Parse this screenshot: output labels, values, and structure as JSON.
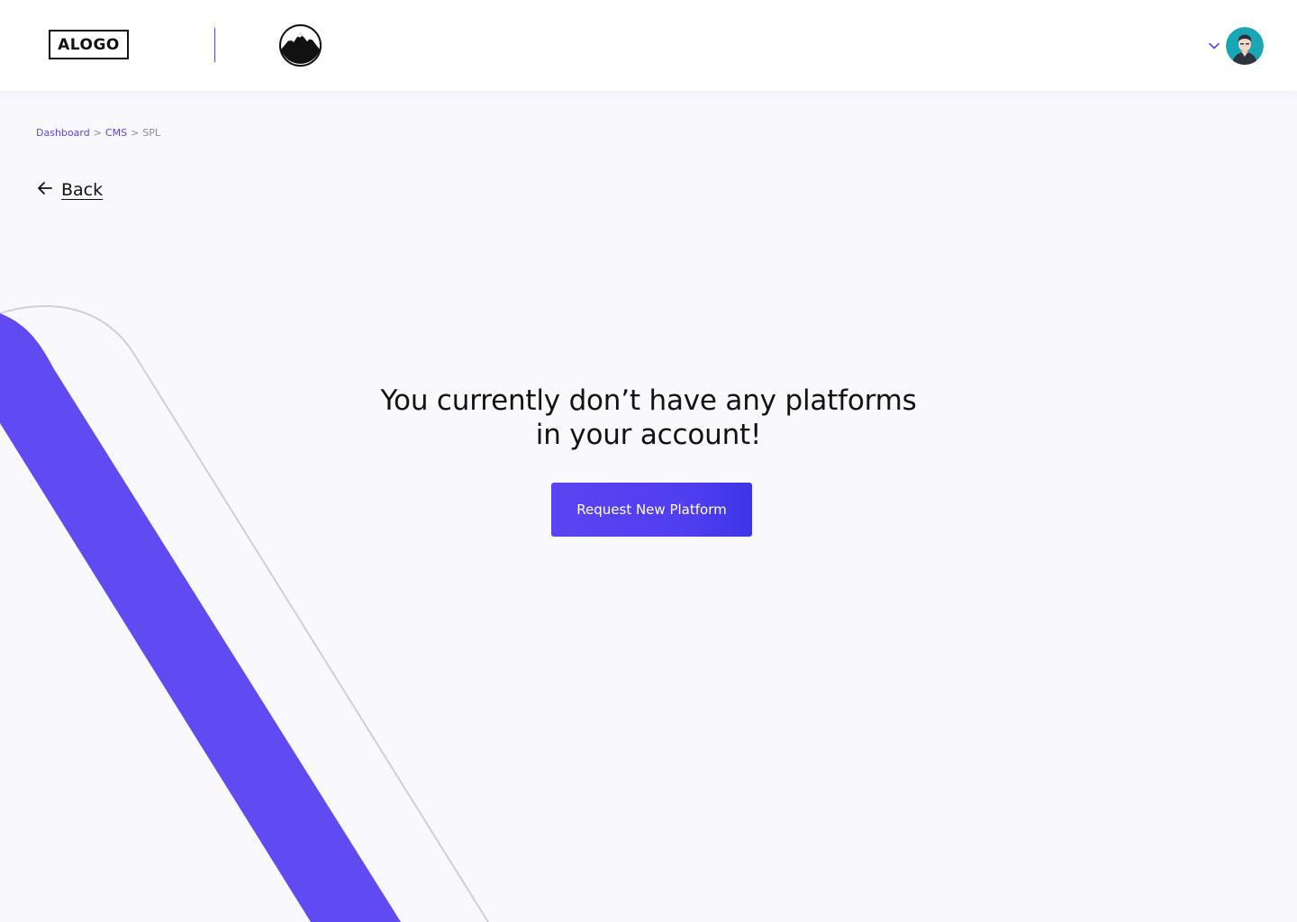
{
  "header": {
    "logo_text": "ALOGO",
    "brand_icon": "mountain-icon",
    "user_menu_icon": "chevron-down-icon",
    "avatar_icon": "user-avatar"
  },
  "breadcrumb": {
    "items": [
      {
        "label": "Dashboard"
      },
      {
        "label": "CMS"
      },
      {
        "label": "SPL"
      }
    ],
    "separator": ">"
  },
  "back": {
    "label": "Back",
    "icon": "arrow-left-icon"
  },
  "empty_state": {
    "title_line1": "You currently don’t have any platforms",
    "title_line2": "in your account!",
    "button_label": "Request New Platform"
  },
  "colors": {
    "accent": "#5b44f2",
    "background": "#f8f8fd",
    "header_bg": "#ffffff",
    "avatar_bg": "#1aa6b5",
    "text": "#121212",
    "muted": "#8a8a99"
  }
}
